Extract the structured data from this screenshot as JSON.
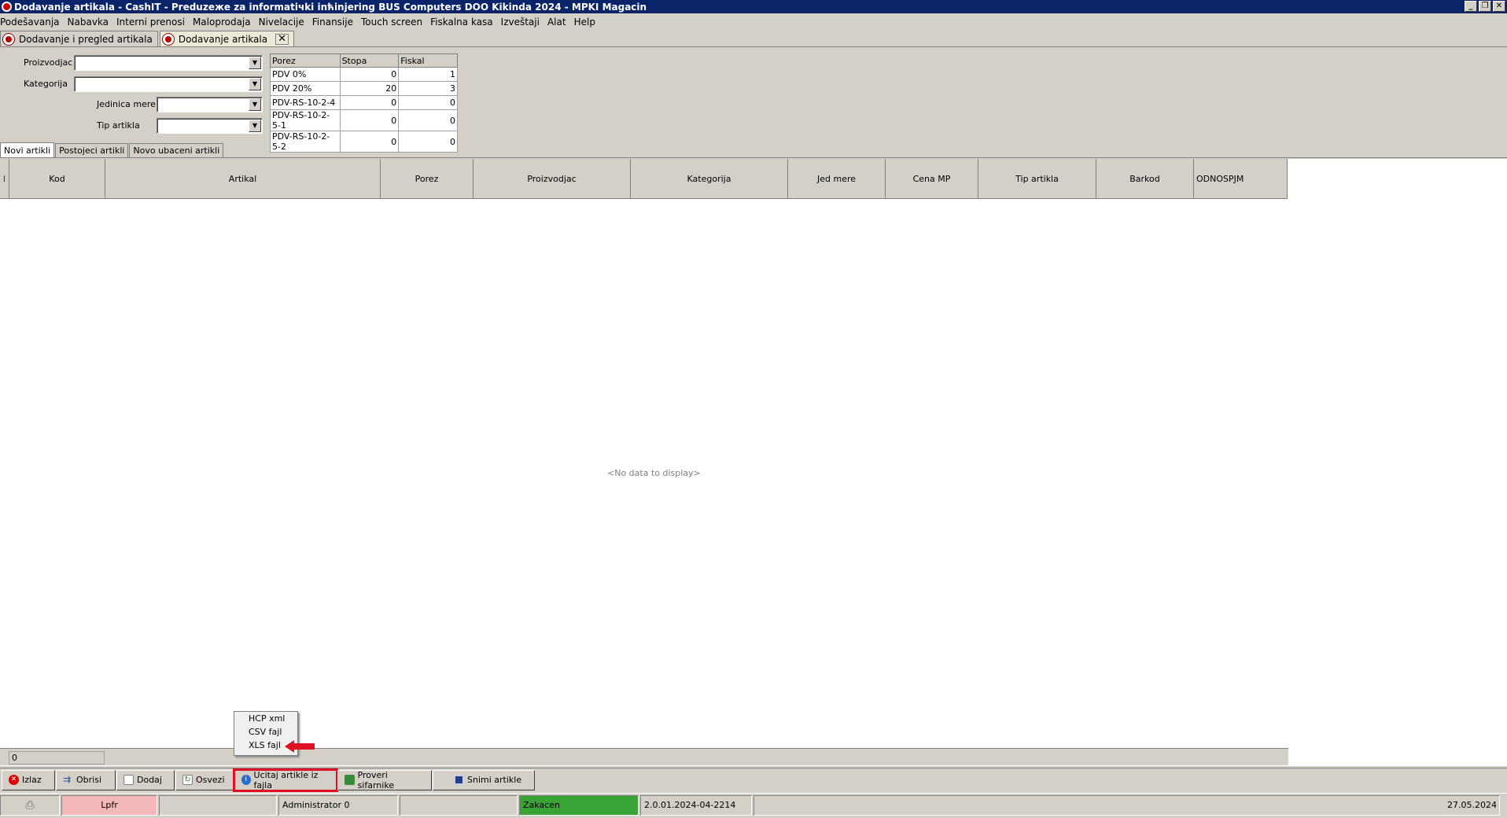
{
  "window": {
    "title": "Dodavanje artikala - CashIT - Preduzeжe za informatiчki inћinjering BUS Computers DOO Kikinda 2024 - MPKI Magacin",
    "minimize": "_",
    "restore": "❐",
    "close": "✕"
  },
  "menu": [
    "Podešavanja",
    "Nabavka",
    "Interni prenosi",
    "Maloprodaja",
    "Nivelacije",
    "Finansije",
    "Touch screen",
    "Fiskalna kasa",
    "Izveštaji",
    "Alat",
    "Help"
  ],
  "doc_tabs": [
    {
      "label": "Dodavanje i pregled artikala"
    },
    {
      "label": "Dodavanje artikala"
    }
  ],
  "doc_tab_close": "✕",
  "filters": {
    "proizvodjac_label": "Proizvodjac",
    "kategorija_label": "Kategorija",
    "jedinica_mere_label": "Jedinica mere",
    "tip_artikla_label": "Tip artikla"
  },
  "tax_table": {
    "headers": [
      "Porez",
      "Stopa",
      "Fiskal"
    ],
    "rows": [
      [
        "PDV 0%",
        "0",
        "1"
      ],
      [
        "PDV 20%",
        "20",
        "3"
      ],
      [
        "PDV-RS-10-2-4",
        "0",
        "0"
      ],
      [
        "PDV-RS-10-2-5-1",
        "0",
        "0"
      ],
      [
        "PDV-RS-10-2-5-2",
        "0",
        "0"
      ]
    ]
  },
  "sub_tabs": [
    "Novi artikli",
    "Postojeci artikli",
    "Novo ubaceni artikli"
  ],
  "grid": {
    "columns": [
      "Kod",
      "Artikal",
      "Porez",
      "Proizvodjac",
      "Kategorija",
      "Jed mere",
      "Cena MP",
      "Tip artikla",
      "Barkod",
      "ODNOSPJM"
    ],
    "empty_text": "<No data to display>",
    "footer_value": "0"
  },
  "popup_menu": [
    "HCP xml",
    "CSV fajl",
    "XLS fajl"
  ],
  "toolbar": {
    "izlaz": "Izlaz",
    "obrisi": "Obrisi",
    "dodaj": "Dodaj",
    "osvezi": "Osvezi",
    "ucitaj": "Ucitaj artikle iz fajla",
    "proveri": "Proveri sifarnike",
    "snimi": "Snimi artikle"
  },
  "status": {
    "lpfr": "Lpfr",
    "user": "Administrator 0",
    "state": "Zakacen",
    "version": "2.0.01.2024-04-2214",
    "date": "27.05.2024"
  },
  "colors": {
    "titlebar": "#0a246a",
    "highlight_red": "#e01020",
    "lpfr_bg": "#f4b8b8",
    "zakacen_bg": "#3aa335"
  }
}
